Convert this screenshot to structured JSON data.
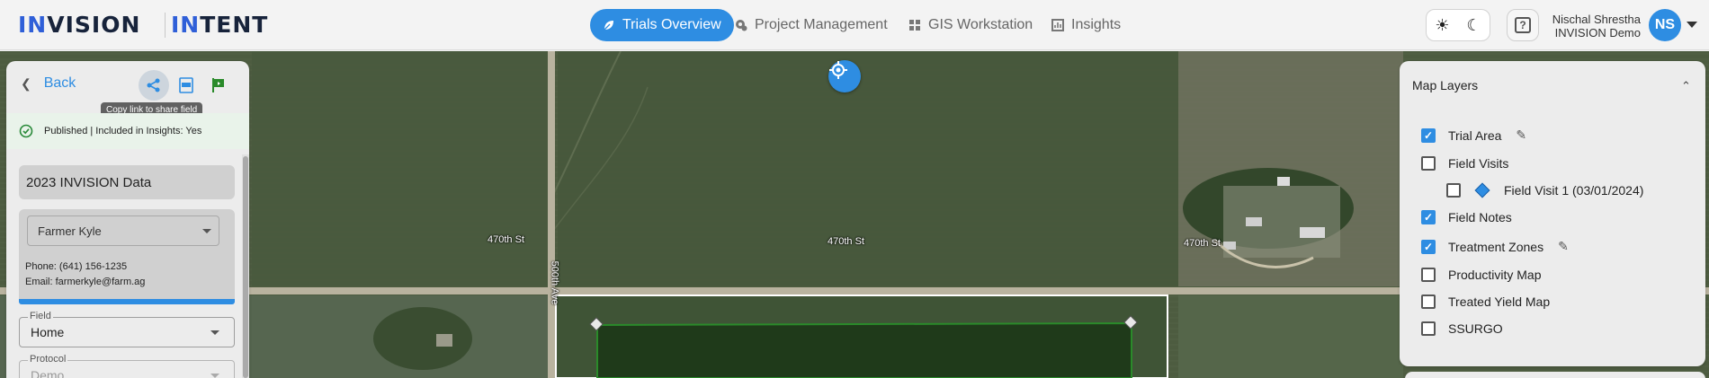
{
  "header": {
    "logo_left_prefix": "IN",
    "logo_left_rest": "VISION",
    "logo_right_prefix": "IN",
    "logo_right_rest": "TENT",
    "nav": [
      {
        "label": "Trials Overview",
        "icon": "leaf-icon",
        "active": true
      },
      {
        "label": "Project Management",
        "icon": "gear-pin-icon",
        "active": false
      },
      {
        "label": "GIS Workstation",
        "icon": "grid-icon",
        "active": false
      },
      {
        "label": "Insights",
        "icon": "chart-box-icon",
        "active": false
      }
    ],
    "theme_icons": [
      "sun-icon",
      "moon-icon"
    ],
    "help_label": "?",
    "user": {
      "name": "Nischal Shrestha",
      "org": "INVISION Demo",
      "initials": "NS"
    }
  },
  "left_panel": {
    "back_label": "Back",
    "tooltip": "Copy link to share field",
    "status": "Published | Included in Insights: Yes",
    "data_label": "2023 INVISION Data",
    "farmer": "Farmer Kyle",
    "phone": "Phone: (641) 156-1235",
    "email": "Email: farmerkyle@farm.ag",
    "field_label": "Field",
    "field_value": "Home",
    "protocol_label": "Protocol",
    "protocol_value": "Demo"
  },
  "map": {
    "road_labels": [
      "470th St",
      "470th St",
      "470th St",
      "500th Ave"
    ]
  },
  "layers_panel": {
    "title": "Map Layers",
    "layers": [
      {
        "label": "Trial Area",
        "checked": true,
        "editable": true
      },
      {
        "label": "Field Visits",
        "checked": false,
        "editable": false
      },
      {
        "label": "Field Visit 1 (03/01/2024)",
        "checked": false,
        "editable": false
      },
      {
        "label": "Field Notes",
        "checked": true,
        "editable": false
      },
      {
        "label": "Treatment Zones",
        "checked": true,
        "editable": true
      },
      {
        "label": "Productivity Map",
        "checked": false,
        "editable": false
      },
      {
        "label": "Treated Yield Map",
        "checked": false,
        "editable": false
      },
      {
        "label": "SSURGO",
        "checked": false,
        "editable": false
      }
    ]
  },
  "colors": {
    "accent": "#2e8de2",
    "logo_dark": "#17233b",
    "logo_accent": "#2f5fd8"
  }
}
